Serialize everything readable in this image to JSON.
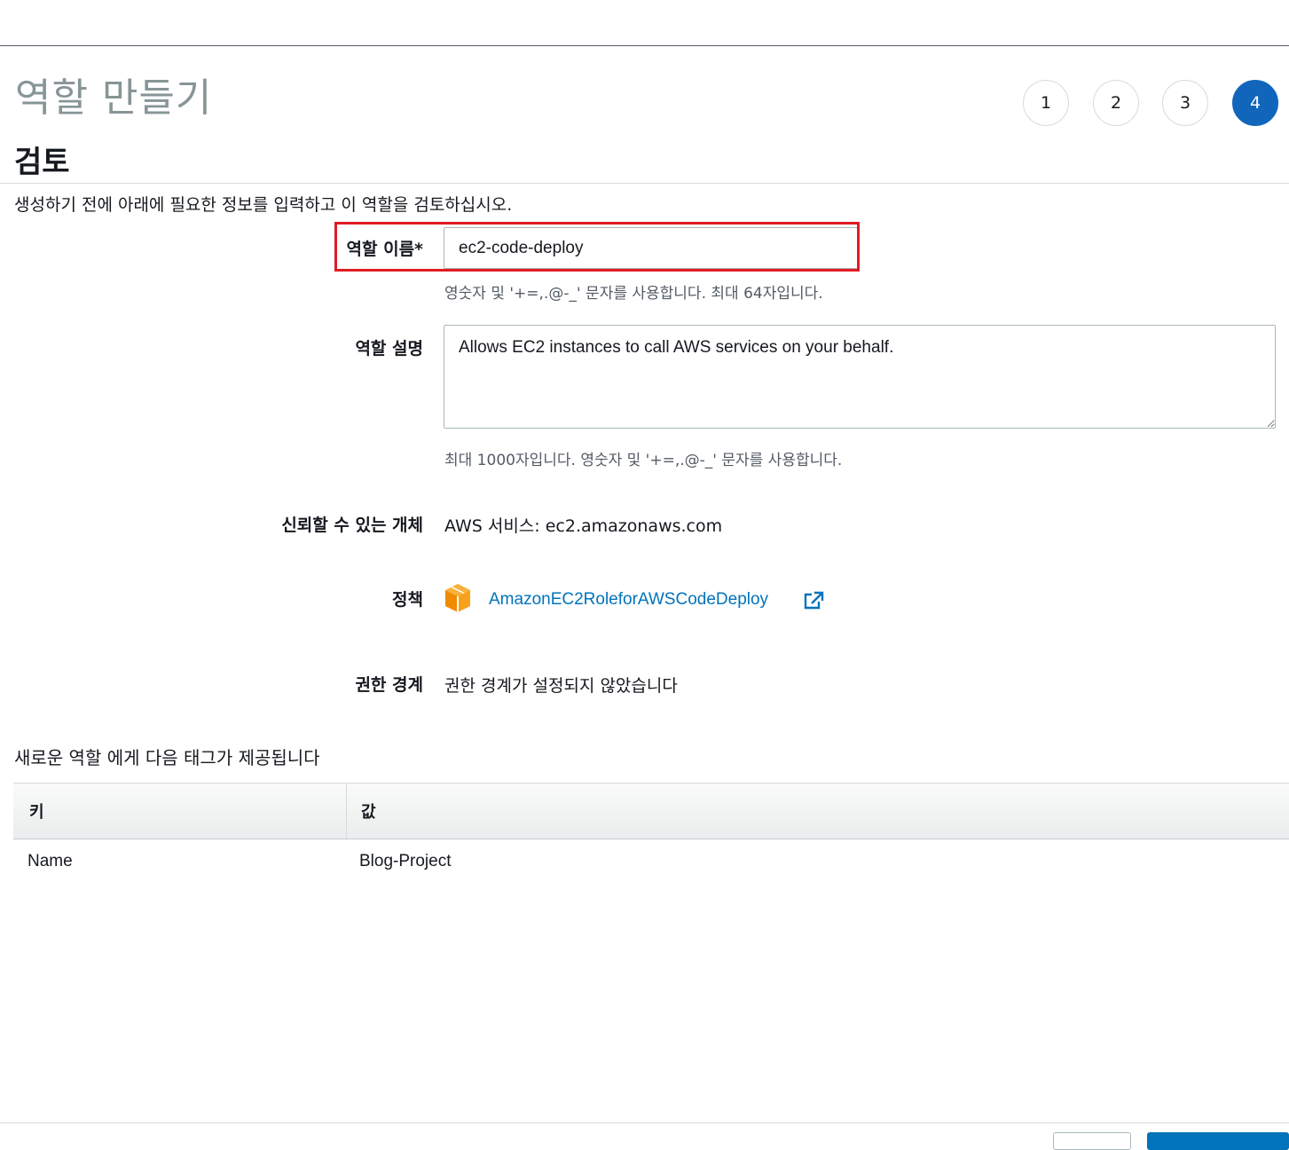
{
  "page": {
    "title": "역할 만들기",
    "steps": [
      {
        "label": "1",
        "active": false
      },
      {
        "label": "2",
        "active": false
      },
      {
        "label": "3",
        "active": false
      },
      {
        "label": "4",
        "active": true
      }
    ],
    "section_title": "검토",
    "intro": "생성하기 전에 아래에 필요한 정보를 입력하고 이 역할을 검토하십시오."
  },
  "form": {
    "role_name": {
      "label": "역할 이름*",
      "value": "ec2-code-deploy",
      "hint": "영숫자 및 '+=,.@-_' 문자를 사용합니다. 최대 64자입니다."
    },
    "role_description": {
      "label": "역할 설명",
      "value": "Allows EC2 instances to call AWS services on your behalf.",
      "hint": "최대 1000자입니다. 영숫자 및 '+=,.@-_' 문자를 사용합니다."
    },
    "trusted_entity": {
      "label": "신뢰할 수 있는 개체",
      "value": "AWS 서비스: ec2.amazonaws.com"
    },
    "policies": {
      "label": "정책",
      "icon": "aws-managed-policy-icon",
      "link": "AmazonEC2RoleforAWSCodeDeploy"
    },
    "permissions_boundary": {
      "label": "권한 경계",
      "value": "권한 경계가 설정되지 않았습니다"
    }
  },
  "tags": {
    "heading": "새로운 역할 에게 다음 태그가 제공됩니다",
    "columns": [
      "키",
      "값"
    ],
    "rows": [
      {
        "key": "Name",
        "value": "Blog-Project"
      }
    ]
  },
  "colors": {
    "accent": "#1166bb",
    "link": "#0073bb",
    "highlight": "#e01b24",
    "policy_icon": "#f7a11a"
  }
}
